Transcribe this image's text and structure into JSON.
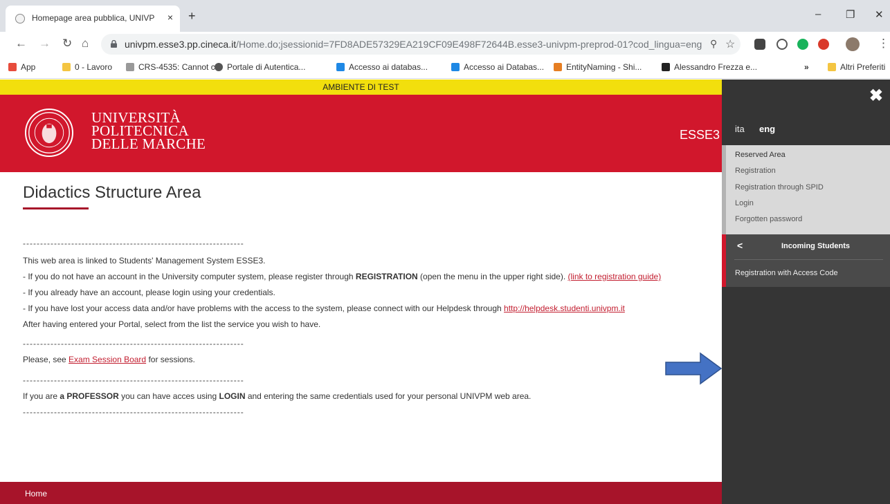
{
  "browser": {
    "tab_title": "Homepage area pubblica, UNIVP",
    "tab_close": "×",
    "new_tab": "+",
    "win_min": "–",
    "win_restore": "❐",
    "win_close": "✕",
    "url_host": "univpm.esse3.pp.cineca.it",
    "url_path": "/Home.do;jsessionid=7FD8ADE57329EA219CF09E498F72644B.esse3-univpm-preprod-01?cod_lingua=eng",
    "bookmarks": [
      {
        "label": "App",
        "color": "#e74c3c"
      },
      {
        "label": "0 - Lavoro",
        "color": "#f4c542"
      },
      {
        "label": "CRS-4535: Cannot c...",
        "color": "#999999"
      },
      {
        "label": "Portale di Autentica...",
        "color": "#555555"
      },
      {
        "label": "Accesso ai databas...",
        "color": "#1e88e5"
      },
      {
        "label": "Accesso ai Databas...",
        "color": "#1e88e5"
      },
      {
        "label": "EntityNaming - Shi...",
        "color": "#e67e22"
      },
      {
        "label": "Alessandro Frezza e...",
        "color": "#222222"
      }
    ],
    "bookmarks_more": "»",
    "other_bookmarks": "Altri Preferiti"
  },
  "page": {
    "test_banner": "AMBIENTE DI TEST",
    "logo_lines": [
      "UNIVERSITÀ",
      "POLITECNICA",
      "DELLE MARCHE"
    ],
    "header_right": "ESSE3 S",
    "title": "Didactics Structure Area",
    "dashes": "----------------------------------------------------------------",
    "lines": {
      "l1": "This web area is linked to Students' Management System ESSE3.",
      "l2a": "- If you do not have an account in the University computer system, please register through ",
      "l2b": "REGISTRATION",
      "l2c": " (open the menu in the upper right side). ",
      "l2link": "(link to registration guide)",
      "l3": "- If you already have an account, please login using your credentials.",
      "l4a": "- If you have lost your access data and/or have problems with the access to the system, please connect with our Helpdesk through ",
      "l4link": "http://helpdesk.studenti.univpm.it",
      "l5": "After having entered your Portal, select from the list the service you wish to have.",
      "l6a": "Please, see ",
      "l6link": "Exam Session Board",
      "l6b": " for sessions.",
      "l7a": "If you are ",
      "l7b": "a PROFESSOR",
      "l7c": " you can have acces using ",
      "l7d": "LOGIN",
      "l7e": " and entering the same credentials used for your personal UNIVPM web area."
    },
    "footer_home": "Home"
  },
  "menu": {
    "close": "✖",
    "lang_ita": "ita",
    "lang_eng": "eng",
    "reserved_area": "Reserved Area",
    "items": [
      "Registration",
      "Registration through SPID",
      "Login",
      "Forgotten password"
    ],
    "back": "<",
    "incoming_title": "Incoming Students",
    "access_code": "Registration with Access Code"
  },
  "colors": {
    "brand_red": "#d1172c",
    "footer_red": "#a7142a",
    "test_yellow": "#f2df0d",
    "menu_dark": "#353535",
    "arrow_blue": "#4472c4"
  }
}
